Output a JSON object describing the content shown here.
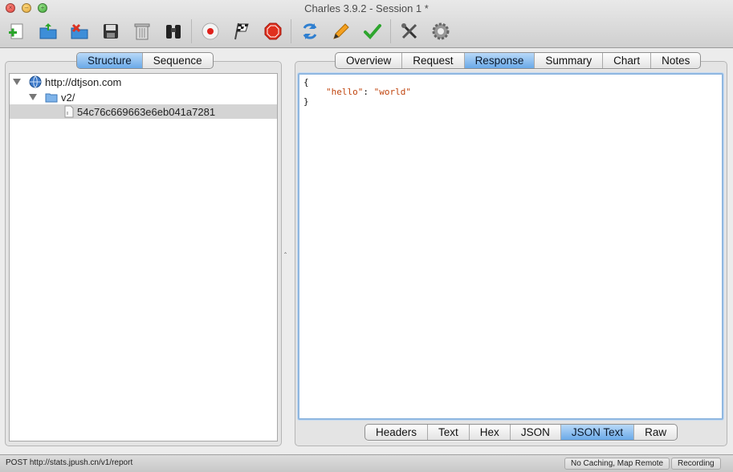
{
  "window": {
    "title": "Charles 3.9.2 - Session 1 *"
  },
  "toolbar": {
    "buttons": [
      {
        "name": "new-session",
        "icon": "new-session-icon"
      },
      {
        "name": "open-session",
        "icon": "open-folder-icon"
      },
      {
        "name": "close-session",
        "icon": "close-session-icon"
      },
      {
        "name": "save-session",
        "icon": "floppy-disk-icon"
      },
      {
        "name": "clear-session",
        "icon": "trash-icon"
      },
      {
        "name": "find",
        "icon": "binoculars-icon"
      },
      {
        "name": "record",
        "icon": "record-icon"
      },
      {
        "name": "throttle",
        "icon": "checkered-flag-icon"
      },
      {
        "name": "breakpoints",
        "icon": "stop-sign-icon"
      },
      {
        "name": "repeat",
        "icon": "refresh-icon"
      },
      {
        "name": "edit",
        "icon": "pencil-icon"
      },
      {
        "name": "validate",
        "icon": "checkmark-icon"
      },
      {
        "name": "tools",
        "icon": "tools-icon"
      },
      {
        "name": "settings",
        "icon": "gear-icon"
      }
    ]
  },
  "left_tabs": [
    "Structure",
    "Sequence"
  ],
  "left_active_tab": "Structure",
  "tree": {
    "host": "http://dtjson.com",
    "folder": "v2/",
    "item": "54c76c669663e6eb041a7281"
  },
  "right_tabs": [
    "Overview",
    "Request",
    "Response",
    "Summary",
    "Chart",
    "Notes"
  ],
  "right_active_tab": "Response",
  "json_view": {
    "open_brace": "{",
    "key": "\"hello\"",
    "colon": ": ",
    "value": "\"world\"",
    "close_brace": "}"
  },
  "bottom_tabs": [
    "Headers",
    "Text",
    "Hex",
    "JSON",
    "JSON Text",
    "Raw"
  ],
  "bottom_active_tab": "JSON Text",
  "divider_handle": "‸",
  "status": {
    "text": "POST http://stats.jpush.cn/v1/report",
    "badge_caching": "No Caching, Map Remote",
    "badge_recording": "Recording"
  },
  "colors": {
    "active_tab": "#6aa9e8",
    "json_string": "#c0450f",
    "selection": "#d4d4d4"
  }
}
